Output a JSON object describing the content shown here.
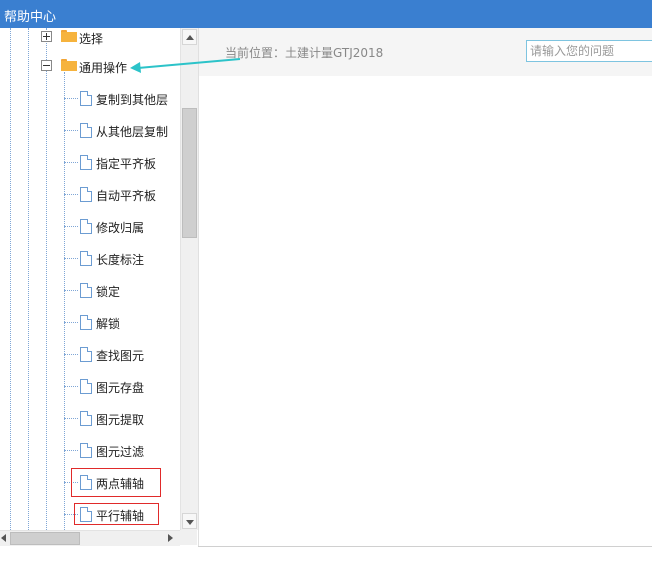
{
  "window": {
    "title": "帮助中心"
  },
  "tree": {
    "items": [
      {
        "label": "选择",
        "type": "folder",
        "expanded": false
      },
      {
        "label": "通用操作",
        "type": "folder",
        "expanded": true
      },
      {
        "label": "复制到其他层",
        "type": "page"
      },
      {
        "label": "从其他层复制",
        "type": "page"
      },
      {
        "label": "指定平齐板",
        "type": "page"
      },
      {
        "label": "自动平齐板",
        "type": "page"
      },
      {
        "label": "修改归属",
        "type": "page"
      },
      {
        "label": "长度标注",
        "type": "page"
      },
      {
        "label": "锁定",
        "type": "page"
      },
      {
        "label": "解锁",
        "type": "page"
      },
      {
        "label": "查找图元",
        "type": "page"
      },
      {
        "label": "图元存盘",
        "type": "page"
      },
      {
        "label": "图元提取",
        "type": "page"
      },
      {
        "label": "图元过滤",
        "type": "page"
      },
      {
        "label": "两点辅轴",
        "type": "page",
        "highlighted": true
      },
      {
        "label": "平行辅轴",
        "type": "page",
        "highlighted": true
      }
    ]
  },
  "content": {
    "breadcrumb": "当前位置：土建计量GTJ2018",
    "search_placeholder": "请输入您的问题"
  },
  "colors": {
    "titlebar": "#3a7fd0",
    "highlight": "#e02a2a",
    "annotation_arrow": "#2cc3c9"
  }
}
